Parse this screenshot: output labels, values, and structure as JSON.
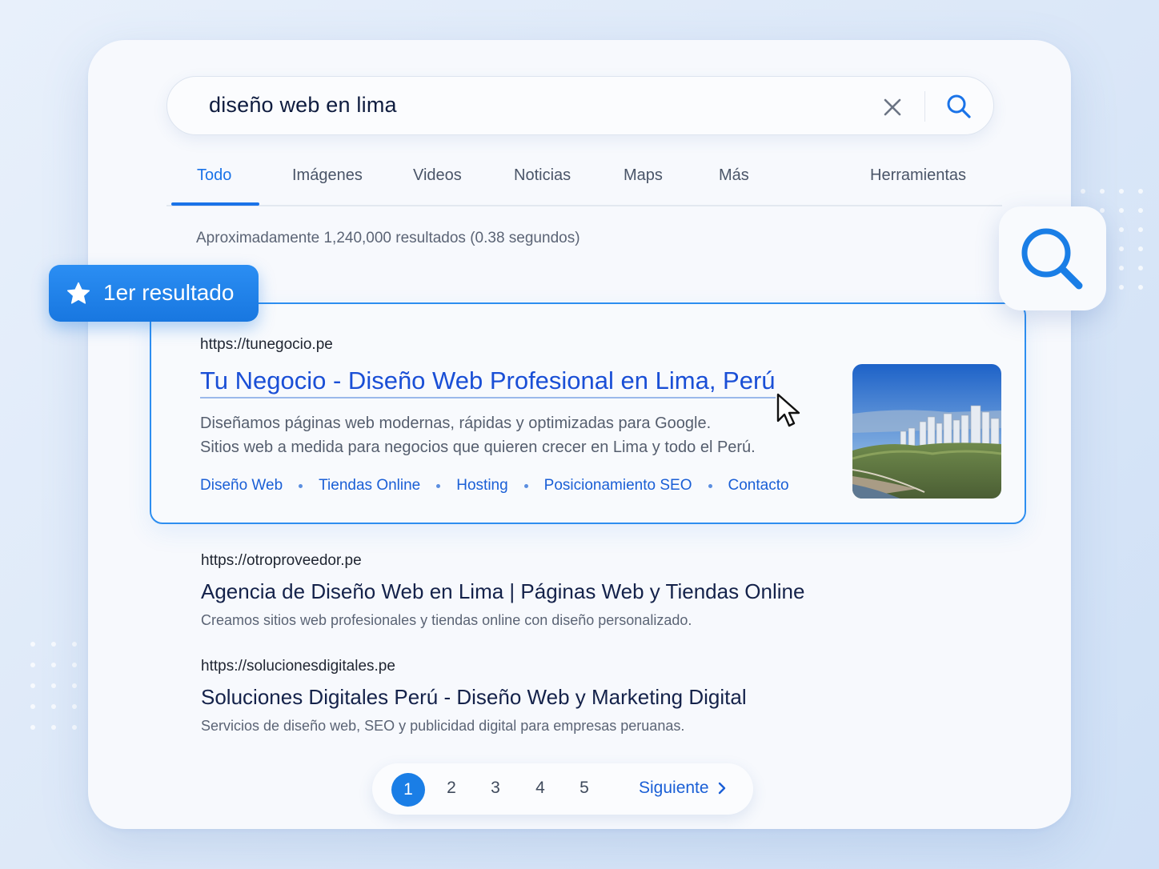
{
  "search": {
    "query": "diseño web en lima"
  },
  "tabs": [
    {
      "label": "Todo",
      "active": true
    },
    {
      "label": "Imágenes"
    },
    {
      "label": "Videos"
    },
    {
      "label": "Noticias"
    },
    {
      "label": "Maps"
    },
    {
      "label": "Más"
    },
    {
      "label": "Herramientas"
    }
  ],
  "result_count": "Aproximadamente 1,240,000 resultados (0.38 segundos)",
  "badge": {
    "label": "1er resultado"
  },
  "featured": {
    "url": "https://tunegocio.pe",
    "title": "Tu Negocio - Diseño Web Profesional en Lima, Perú",
    "desc_line1": "Diseñamos páginas web modernas, rápidas y optimizadas para Google.",
    "desc_line2": "Sitios web a medida para negocios que quieren crecer en Lima y todo el Perú.",
    "sitelinks": [
      "Diseño Web",
      "Tiendas Online",
      "Hosting",
      "Posicionamiento SEO",
      "Contacto"
    ]
  },
  "results": [
    {
      "url": "https://otroproveedor.pe",
      "title": "Agencia de Diseño Web en Lima | Páginas Web y Tiendas Online",
      "desc": "Creamos sitios web profesionales y tiendas online con diseño personalizado."
    },
    {
      "url": "https://solucionesdigitales.pe",
      "title": "Soluciones Digitales Perú - Diseño Web y Marketing Digital",
      "desc": "Servicios de diseño web, SEO y publicidad digital para empresas peruanas."
    }
  ],
  "pagination": {
    "current": "1",
    "pages": [
      "2",
      "3",
      "4",
      "5"
    ],
    "next_label": "Siguiente"
  },
  "colors": {
    "accent": "#1a73e8",
    "link": "#1a4fd6",
    "featured_border": "#2d8ef0"
  }
}
